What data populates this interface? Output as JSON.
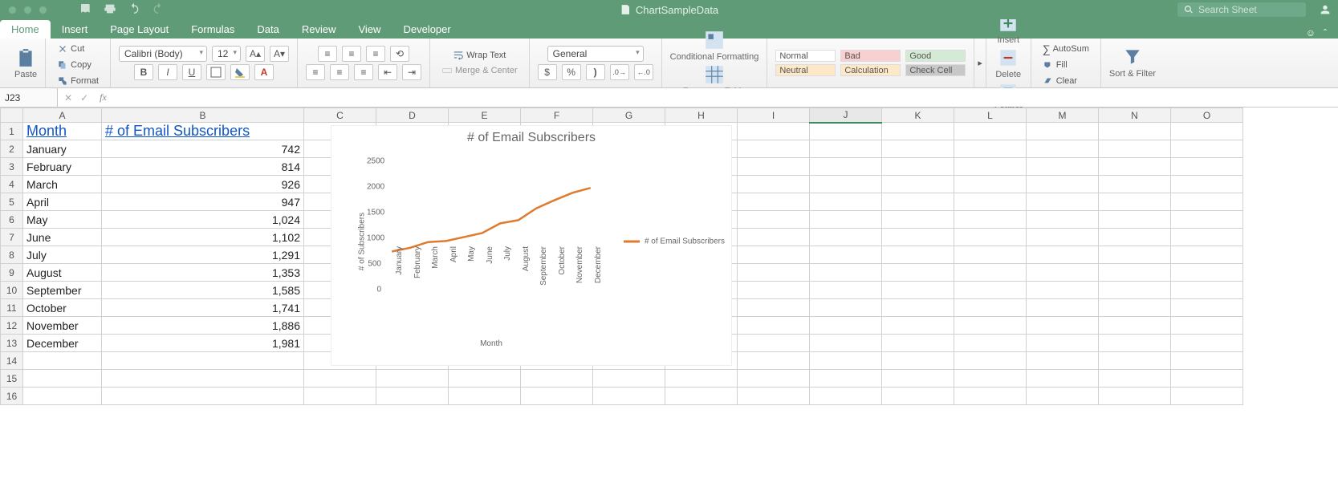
{
  "window": {
    "title": "ChartSampleData",
    "search_placeholder": "Search Sheet"
  },
  "menu": {
    "tabs": [
      "Home",
      "Insert",
      "Page Layout",
      "Formulas",
      "Data",
      "Review",
      "View",
      "Developer"
    ],
    "active": 0
  },
  "ribbon": {
    "clipboard": {
      "paste": "Paste",
      "cut": "Cut",
      "copy": "Copy",
      "format": "Format"
    },
    "font": {
      "family": "Calibri (Body)",
      "size": "12",
      "bold": "B",
      "italic": "I",
      "underline": "U"
    },
    "alignment": {
      "wrap": "Wrap Text",
      "merge": "Merge & Center"
    },
    "number": {
      "format": "General",
      "currency": "$",
      "percent": "%",
      "comma": ",",
      "inc": ".0",
      "dec": ".00"
    },
    "cond": {
      "cond": "Conditional Formatting",
      "table": "Format as Table"
    },
    "styles": {
      "normal": "Normal",
      "bad": "Bad",
      "good": "Good",
      "neutral": "Neutral",
      "calc": "Calculation",
      "check": "Check Cell"
    },
    "cells": {
      "insert": "Insert",
      "delete": "Delete",
      "format": "Format"
    },
    "editing": {
      "autosum": "AutoSum",
      "fill": "Fill",
      "clear": "Clear",
      "sort": "Sort & Filter"
    }
  },
  "formula_bar": {
    "name": "J23",
    "fx": "fx",
    "value": ""
  },
  "columns": [
    "A",
    "B",
    "C",
    "D",
    "E",
    "F",
    "G",
    "H",
    "I",
    "J",
    "K",
    "L",
    "M",
    "N",
    "O"
  ],
  "active_col": "J",
  "header": {
    "month": "Month",
    "subs": "# of Email Subscribers"
  },
  "rows": [
    {
      "month": "January",
      "value": "742",
      "n": 742
    },
    {
      "month": "February",
      "value": "814",
      "n": 814
    },
    {
      "month": "March",
      "value": "926",
      "n": 926
    },
    {
      "month": "April",
      "value": "947",
      "n": 947
    },
    {
      "month": "May",
      "value": "1,024",
      "n": 1024
    },
    {
      "month": "June",
      "value": "1,102",
      "n": 1102
    },
    {
      "month": "July",
      "value": "1,291",
      "n": 1291
    },
    {
      "month": "August",
      "value": "1,353",
      "n": 1353
    },
    {
      "month": "September",
      "value": "1,585",
      "n": 1585
    },
    {
      "month": "October",
      "value": "1,741",
      "n": 1741
    },
    {
      "month": "November",
      "value": "1,886",
      "n": 1886
    },
    {
      "month": "December",
      "value": "1,981",
      "n": 1981
    }
  ],
  "chart_data": {
    "type": "line",
    "title": "# of Email Subscribers",
    "xlabel": "Month",
    "ylabel": "# of Subscribers",
    "ylim": [
      0,
      2500
    ],
    "yticks": [
      0,
      500,
      1000,
      1500,
      2000,
      2500
    ],
    "categories": [
      "January",
      "February",
      "March",
      "April",
      "May",
      "June",
      "July",
      "August",
      "September",
      "October",
      "November",
      "December"
    ],
    "series": [
      {
        "name": "# of Email Subscribers",
        "values": [
          742,
          814,
          926,
          947,
          1024,
          1102,
          1291,
          1353,
          1585,
          1741,
          1886,
          1981
        ],
        "color": "#e07a2e"
      }
    ]
  }
}
